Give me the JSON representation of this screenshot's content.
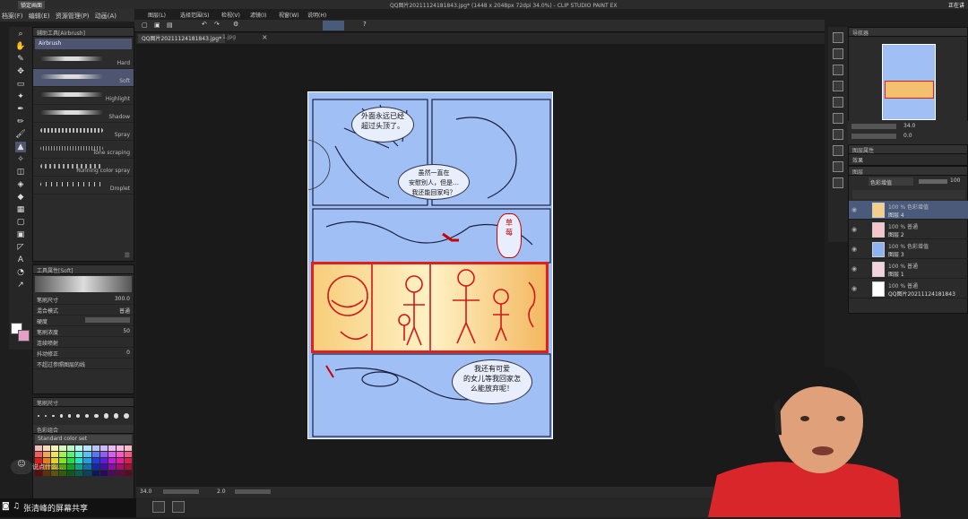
{
  "window": {
    "title": "QQ图片20211124181843.jpg* (1448 x 2048px 72dpi 34.0%) - CLIP STUDIO PAINT EX",
    "menu_left": "锁定画面",
    "recording_status": "正在讲"
  },
  "menu": [
    "档案(F)",
    "编辑(E)",
    "画",
    "资源管理(P)",
    "动画(A)",
    "图层(L)",
    "选择范围(S)",
    "检视(V)",
    "滤镜(I)",
    "视窗(W)",
    "说明(H)"
  ],
  "tabs": {
    "active": "QQ图片20211124181843.jpg*",
    "second": "1.jpg"
  },
  "subtool": {
    "panel_title": "辅助工具[Airbrush]",
    "group": "Airbrush",
    "brushes": [
      {
        "label": "Hard",
        "selected": false
      },
      {
        "label": "Soft",
        "selected": true
      },
      {
        "label": "Highlight",
        "selected": false
      },
      {
        "label": "Shadow",
        "selected": false
      },
      {
        "label": "Spray",
        "selected": false
      },
      {
        "label": "Tone scraping",
        "selected": false
      },
      {
        "label": "Running color spray",
        "selected": false
      },
      {
        "label": "Droplet",
        "selected": false
      }
    ]
  },
  "tool_props": {
    "title": "工具属性[Soft]",
    "rows": [
      {
        "label": "笔刷尺寸",
        "value": "300.0"
      },
      {
        "label": "混合模式",
        "value": "普通"
      },
      {
        "label": "硬度",
        "value": ""
      },
      {
        "label": "笔刷浓度",
        "value": "50"
      },
      {
        "label": "连续喷射",
        "value": ""
      },
      {
        "label": "抖动修正",
        "value": "0"
      },
      {
        "label": "不超过参照图层的线",
        "value": ""
      }
    ]
  },
  "color": {
    "brush_size_title": "笔刷尺寸",
    "set_title": "色彩组合",
    "set_name": "Standard color set",
    "sizes": [
      "1",
      "1.5",
      "2",
      "2.5",
      "3",
      "4",
      "5",
      "6",
      "7",
      "8",
      "10"
    ]
  },
  "navigator": {
    "title": "导航器",
    "zoom": "34.0",
    "angle": "0.0"
  },
  "layer_property": {
    "title": "图层属性",
    "effect_label": "效果"
  },
  "layers": {
    "title": "图层",
    "blend_mode": "色彩增值",
    "opacity": "100",
    "items": [
      {
        "mode": "100 % 色彩增值",
        "name": "图层 4",
        "color": "#f3cf8a",
        "selected": true
      },
      {
        "mode": "100 % 普通",
        "name": "图层 2",
        "color": "#f5c4cc",
        "selected": false
      },
      {
        "mode": "100 % 色彩增值",
        "name": "图层 3",
        "color": "#8db3f0",
        "selected": false
      },
      {
        "mode": "100 % 普通",
        "name": "图层 1",
        "color": "#f3d2dd",
        "selected": false
      },
      {
        "mode": "100 % 普通",
        "name": "QQ图片20211124181843",
        "color": "#ffffff",
        "selected": false
      }
    ]
  },
  "status": {
    "zoom": "34.0",
    "angle": "2.0"
  },
  "comic": {
    "bubble1": "外面永远已经\n超过头顶了。",
    "bubble2": "虽然一直在\n安慰别人，但是…\n我还能回家吗？",
    "bubble3": "我还有可爱\n的女儿等我回家怎\n么能放弃呢！",
    "bubble4": "草\n莓"
  },
  "taskbar": {
    "share_label": "张清峰的屏幕共享",
    "chat_hint": "说点什么..."
  }
}
